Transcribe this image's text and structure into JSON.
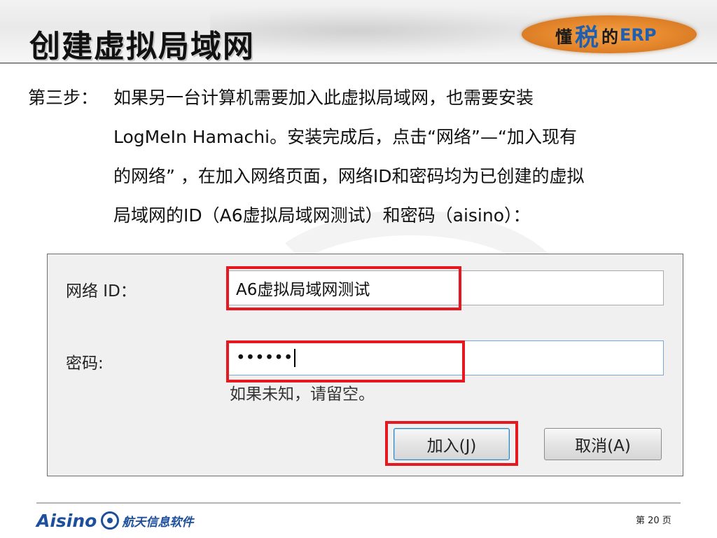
{
  "header": {
    "title": "创建虚拟局域网",
    "logo": {
      "prefix": "懂",
      "middle": "税",
      "suffix": "的",
      "erp": "ERP"
    }
  },
  "body": {
    "step_label": "第三步：",
    "lines": [
      "如果另一台计算机需要加入此虚拟局域网，也需要安装",
      "LogMeIn Hamachi。安装完成后，点击“网络”—“加入现有",
      "的网络” ，在加入网络页面，网络ID和密码均为已创建的虚拟",
      "局域网的ID（A6虚拟局域网测试）和密码（aisino）："
    ]
  },
  "dialog": {
    "network_id_label": "网络 ID：",
    "network_id_value": "A6虚拟局域网测试",
    "password_label": "密码:",
    "password_value": "••••••",
    "hint": "如果未知，请留空。",
    "join_button": "加入(J)",
    "cancel_button": "取消(A)"
  },
  "footer": {
    "brand_en": "Aisino",
    "brand_cn": "航天信息软件",
    "page_label": "第 20 页"
  },
  "colors": {
    "highlight": "#e5191f",
    "brand_blue": "#1d4f9c",
    "logo_orange": "#e6872c"
  }
}
